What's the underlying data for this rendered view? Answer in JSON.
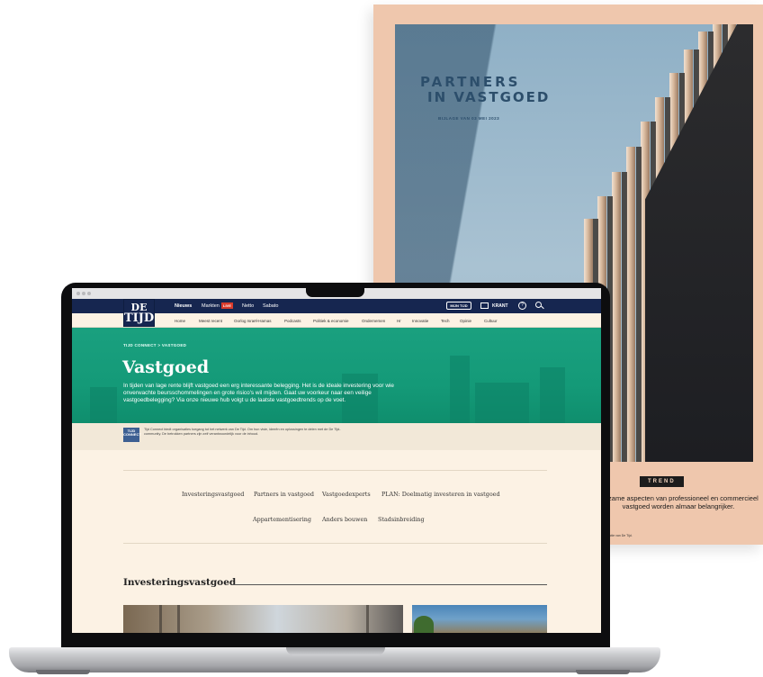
{
  "magazine": {
    "title_line1": "PARTNERS",
    "title_line2": "IN VASTGOED",
    "subtitle": "BIJLAGE VAN 03 MEI 2023",
    "badge": "TREND",
    "lead": "uurzame aspecten van professioneel en commercieel vastgoed worden almaar belangrijker.",
    "footnote": "an de redactie van De Tijd."
  },
  "site": {
    "logo_top": "DE",
    "logo_bottom": "TIJD",
    "nav": [
      "Nieuws",
      "Markten",
      "Netto",
      "Sabato"
    ],
    "live_badge": "LIVE",
    "mijn_tijd": "MIJN TIJD",
    "krant": "KRANT",
    "subnav": [
      "Home",
      "Meest recent",
      "Oorlog Israël-Hamas",
      "Podcasts",
      "Politiek & economie",
      "Ondernemen",
      "Hr",
      "Innovatie",
      "Tech",
      "Opinie",
      "Cultuur"
    ],
    "breadcrumb": "TIJD CONNECT  >  VASTGOED",
    "hero_title": "Vastgoed",
    "hero_text": "In tijden van lage rente blijft vastgoed een erg interessante belegging. Het is de ideale investering voor wie onverwachte beursschommelingen en grote risico's wil mijden. Gaat uw voorkeur naar een veilige vastgoedbelegging? Via onze nieuwe hub volgt u de laatste vastgoedtrends op de voet.",
    "connect_logo": "TIJD CONNECT",
    "connect_text": "Tijd Connect biedt organisaties toegang tot het netwerk van De Tijd. Om hun visie, ideeën en oplossingen te delen met de De Tijd-community. De betrokken partners zijn zelf verantwoordelijk voor de inhoud.",
    "tags_row1": [
      "Investeringsvastgoed",
      "Partners in vastgoed",
      "Vastgoedexperts",
      "PLAN: Doelmatig investeren in vastgoed"
    ],
    "tags_row2": [
      "Appartementisering",
      "Anders bouwen",
      "Stadsinbreiding"
    ],
    "section_title": "Investeringsvastgoed"
  }
}
